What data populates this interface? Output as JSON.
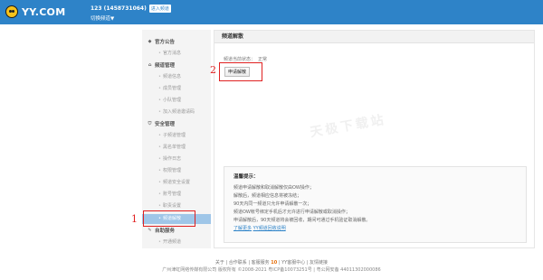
{
  "header": {
    "logo_text": "YY.COM",
    "user": "123 (1458731064)",
    "enter_badge": "进入频道",
    "switch_channel": "切换频道▼"
  },
  "sidebar": {
    "sections": [
      {
        "icon": "announcement-icon",
        "label": "官方公告",
        "items": [
          "官方消息"
        ]
      },
      {
        "icon": "home-icon",
        "label": "频道管理",
        "items": [
          "频道信息",
          "成员管理",
          "小队管理",
          "加入频道邀请码"
        ]
      },
      {
        "icon": "shield-icon",
        "label": "安全管理",
        "items": [
          "子频道管理",
          "黑名单管理",
          "操作日志",
          "权限管理",
          "频道安全设置",
          "账号管理",
          "职责设置",
          "频道解散"
        ]
      },
      {
        "icon": "pencil-icon",
        "label": "自助服务",
        "items": [
          "开通频道"
        ]
      }
    ],
    "active_item": "频道解散"
  },
  "content": {
    "title": "频道解散",
    "status_label": "频道当前状态：",
    "status_value": "正常",
    "apply_button": "申请解散",
    "watermark": "天极下载站",
    "tips": {
      "title": "温馨提示：",
      "lines": [
        "频道申请解散和取消解散仅由OW操作；",
        "解散后，频道相应信息将被冻结；",
        "90天内同一频道只允许申请解散一次；",
        "频道OW帐号绑定手机后才允许进行申请解散或取消操作；",
        "申请解散后，90天频道将会被回收，期间可通过手机验证取消解散。"
      ],
      "link_more": "了解更多",
      "link_guide": "YY频道回收说明"
    }
  },
  "annotations": {
    "step1": "1",
    "step2": "2",
    "color": "#e02020"
  },
  "footer": {
    "links": "关于 | 合作联系 | 客服服务",
    "highlight": "10",
    "links2": "| YY客服中心 | 友情链接",
    "company": "广州津虹网络传媒有限公司 版权所有 ©2008-2021 粤ICP备10073251号 | 粤公网安备 44011302000086"
  },
  "colors": {
    "brand_blue": "#2e83c8",
    "active_item_bg": "#9fc6e8"
  }
}
